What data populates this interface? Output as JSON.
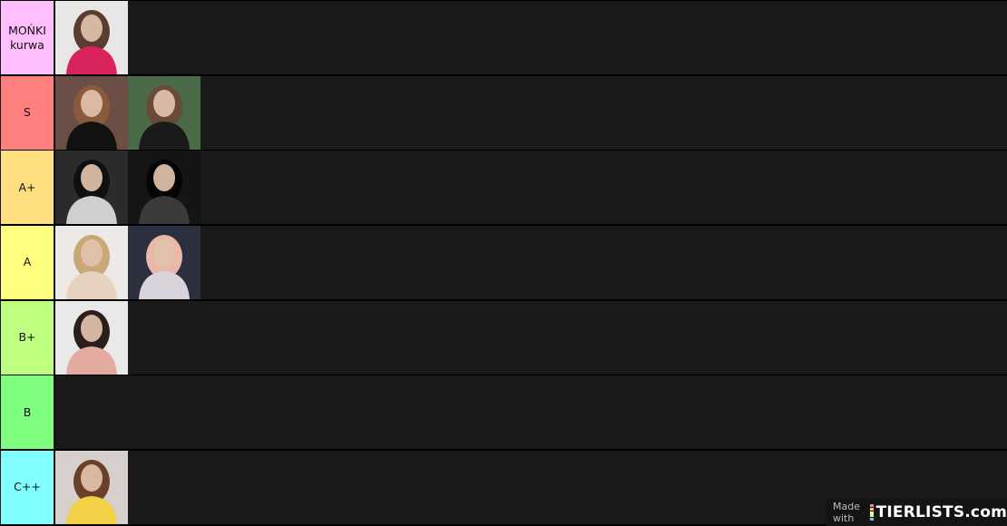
{
  "tiers": [
    {
      "label": "MOŃKI\nkurwa",
      "color": "#ffbfff",
      "items": [
        {
          "name": "photo-girl-pink-sweater-mirror",
          "bg": "#e9e6e6",
          "fg": "#d8245a",
          "hair": "#5b3c2e"
        }
      ]
    },
    {
      "label": "S",
      "color": "#ff7f7f",
      "items": [
        {
          "name": "photo-girl-dark-room",
          "bg": "#6b4e46",
          "fg": "#121212",
          "hair": "#8a5a3c"
        },
        {
          "name": "photo-girl-trees",
          "bg": "#4a6a48",
          "fg": "#1a1a1a",
          "hair": "#6a4a3a"
        }
      ]
    },
    {
      "label": "A+",
      "color": "#ffdf80",
      "items": [
        {
          "name": "photo-girl-bw-portrait",
          "bg": "#2b2b2b",
          "fg": "#cfcfcf",
          "hair": "#101010"
        },
        {
          "name": "photo-girl-bw-dark",
          "bg": "#151515",
          "fg": "#3a3a3a",
          "hair": "#050505"
        }
      ]
    },
    {
      "label": "A",
      "color": "#ffff7f",
      "items": [
        {
          "name": "photo-girl-blonde",
          "bg": "#ece9e6",
          "fg": "#e7d2bf",
          "hair": "#c9a776"
        },
        {
          "name": "photo-girl-pink-hair",
          "bg": "#2b2f3e",
          "fg": "#d9d4dc",
          "hair": "#e9b8a8"
        }
      ]
    },
    {
      "label": "B+",
      "color": "#bfff7f",
      "items": [
        {
          "name": "photo-girl-red-lips",
          "bg": "#e9e9ea",
          "fg": "#e3aaa0",
          "hair": "#2a1f1d"
        }
      ]
    },
    {
      "label": "B",
      "color": "#7fff7f",
      "items": []
    },
    {
      "label": "C++",
      "color": "#7fffff",
      "items": [
        {
          "name": "photo-girl-yellow-top",
          "bg": "#d7cfcc",
          "fg": "#f2d148",
          "hair": "#6b3f2a"
        }
      ]
    }
  ],
  "watermark": {
    "made_with": "Made with",
    "logo": "TIERLISTS.com",
    "bar_colors": [
      "#ff7f7f",
      "#ffbf7f",
      "#ffff7f",
      "#bfff7f",
      "#7fbfff"
    ]
  }
}
